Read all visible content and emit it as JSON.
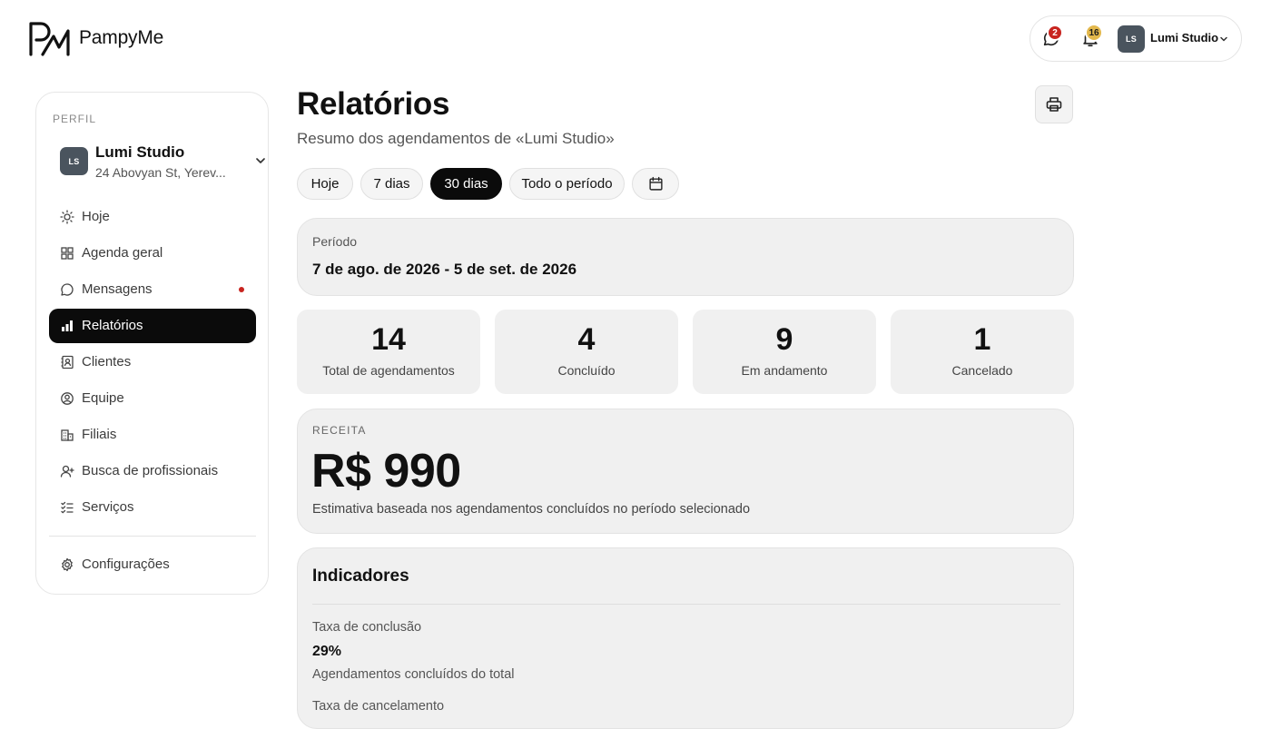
{
  "brand": {
    "name": "PampyMe"
  },
  "topbar": {
    "messages_badge": "2",
    "notifications_badge": "16",
    "avatar_initials": "LS",
    "user_name": "Lumi Studio",
    "colors": {
      "messages_badge": "#c8241f",
      "notifications_badge": "#e3b84c"
    }
  },
  "sidebar": {
    "section_label": "PERFIL",
    "profile": {
      "initials": "LS",
      "name": "Lumi Studio",
      "address": "24 Abovyan St, Yerev..."
    },
    "items": [
      {
        "label": "Hoje",
        "icon": "sun-icon"
      },
      {
        "label": "Agenda geral",
        "icon": "grid-icon"
      },
      {
        "label": "Mensagens",
        "icon": "chat-bubble-icon",
        "has_unread_dot": true
      },
      {
        "label": "Relatórios",
        "icon": "bar-chart-icon",
        "active": true
      },
      {
        "label": "Clientes",
        "icon": "contacts-icon"
      },
      {
        "label": "Equipe",
        "icon": "user-circle-icon"
      },
      {
        "label": "Filiais",
        "icon": "building-icon"
      },
      {
        "label": "Busca de profissionais",
        "icon": "user-plus-icon"
      },
      {
        "label": "Serviços",
        "icon": "checklist-icon"
      }
    ],
    "settings": {
      "label": "Configurações",
      "icon": "gear-icon"
    }
  },
  "main": {
    "title": "Relatórios",
    "subtitle": "Resumo dos agendamentos de «Lumi Studio»",
    "filters": [
      {
        "label": "Hoje",
        "active": false
      },
      {
        "label": "7 dias",
        "active": false
      },
      {
        "label": "30 dias",
        "active": true
      },
      {
        "label": "Todo o período",
        "active": false
      }
    ],
    "period": {
      "label": "Período",
      "value": "7 de ago. de 2026 - 5 de set. de 2026"
    },
    "stats": [
      {
        "value": "14",
        "label": "Total de agendamentos"
      },
      {
        "value": "4",
        "label": "Concluído"
      },
      {
        "value": "9",
        "label": "Em andamento"
      },
      {
        "value": "1",
        "label": "Cancelado"
      }
    ],
    "revenue": {
      "label": "RECEITA",
      "value": "R$ 990",
      "note": "Estimativa baseada nos agendamentos concluídos no período selecionado"
    },
    "indicators": {
      "title": "Indicadores",
      "items": [
        {
          "label": "Taxa de conclusão",
          "value": "29%",
          "note": "Agendamentos concluídos do total"
        },
        {
          "label": "Taxa de cancelamento"
        }
      ]
    }
  }
}
